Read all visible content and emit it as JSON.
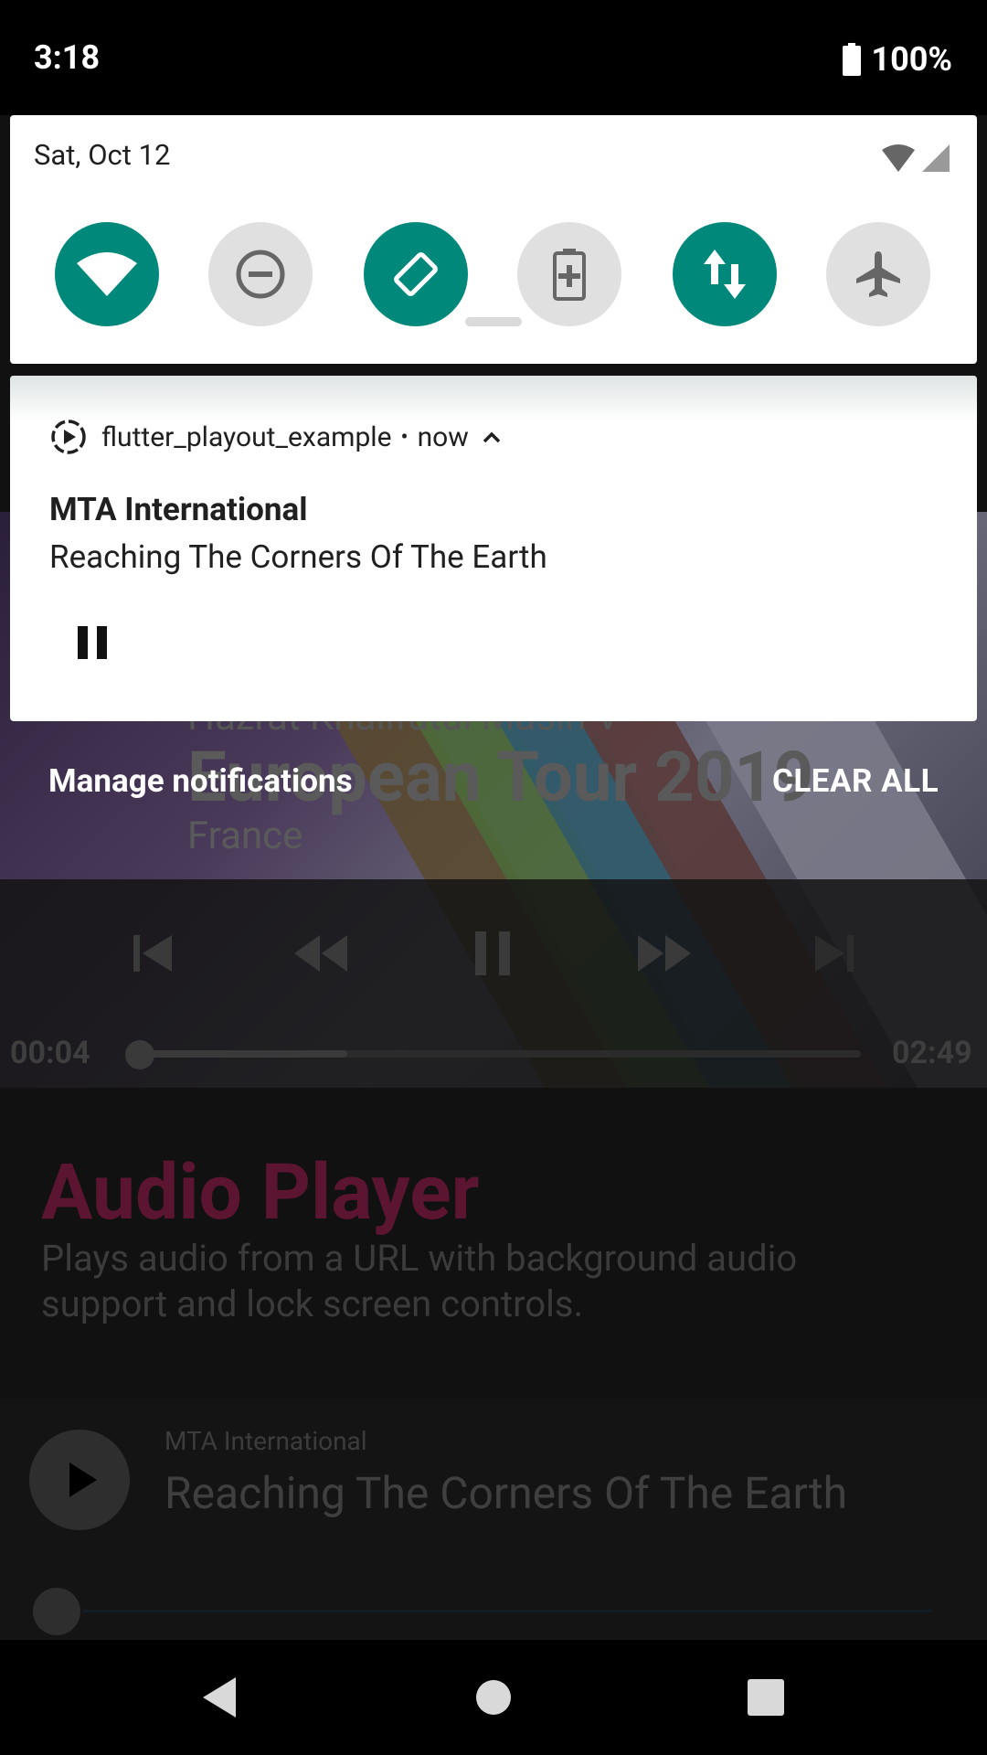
{
  "status_bar": {
    "time": "3:18",
    "battery_percent": "100%"
  },
  "quick_settings": {
    "date": "Sat, Oct 12",
    "accent_color": "#00897b",
    "tiles": [
      {
        "name": "wifi",
        "state": "on",
        "icon": "wifi-icon"
      },
      {
        "name": "do-not-disturb",
        "state": "off",
        "icon": "do-not-disturb-icon"
      },
      {
        "name": "auto-rotate",
        "state": "on",
        "icon": "auto-rotate-icon"
      },
      {
        "name": "battery-saver",
        "state": "off",
        "icon": "battery-saver-icon"
      },
      {
        "name": "mobile-data",
        "state": "on",
        "icon": "mobile-data-icon"
      },
      {
        "name": "airplane-mode",
        "state": "off",
        "icon": "airplane-icon"
      }
    ]
  },
  "notification": {
    "app_name": "flutter_playout_example",
    "separator": "•",
    "time": "now",
    "title": "MTA International",
    "text": "Reaching The Corners Of The Earth",
    "action_icon": "pause-icon"
  },
  "shade_footer": {
    "manage": "Manage notifications",
    "clear_all": "CLEAR ALL"
  },
  "background_app": {
    "video": {
      "subtitle_partial": "Hazrat Khalifatul Masih V",
      "title": "European Tour 2019",
      "location": "France",
      "elapsed": "00:04",
      "duration": "02:49",
      "progress": 0.29
    },
    "section_title": "Audio Player",
    "section_desc": "Plays audio from a URL with background audio support and lock screen controls.",
    "mini_player": {
      "artist": "MTA International",
      "title": "Reaching The Corners Of The Earth",
      "state": "paused"
    }
  },
  "nav_bar": {
    "buttons": [
      "back",
      "home",
      "recents"
    ]
  }
}
